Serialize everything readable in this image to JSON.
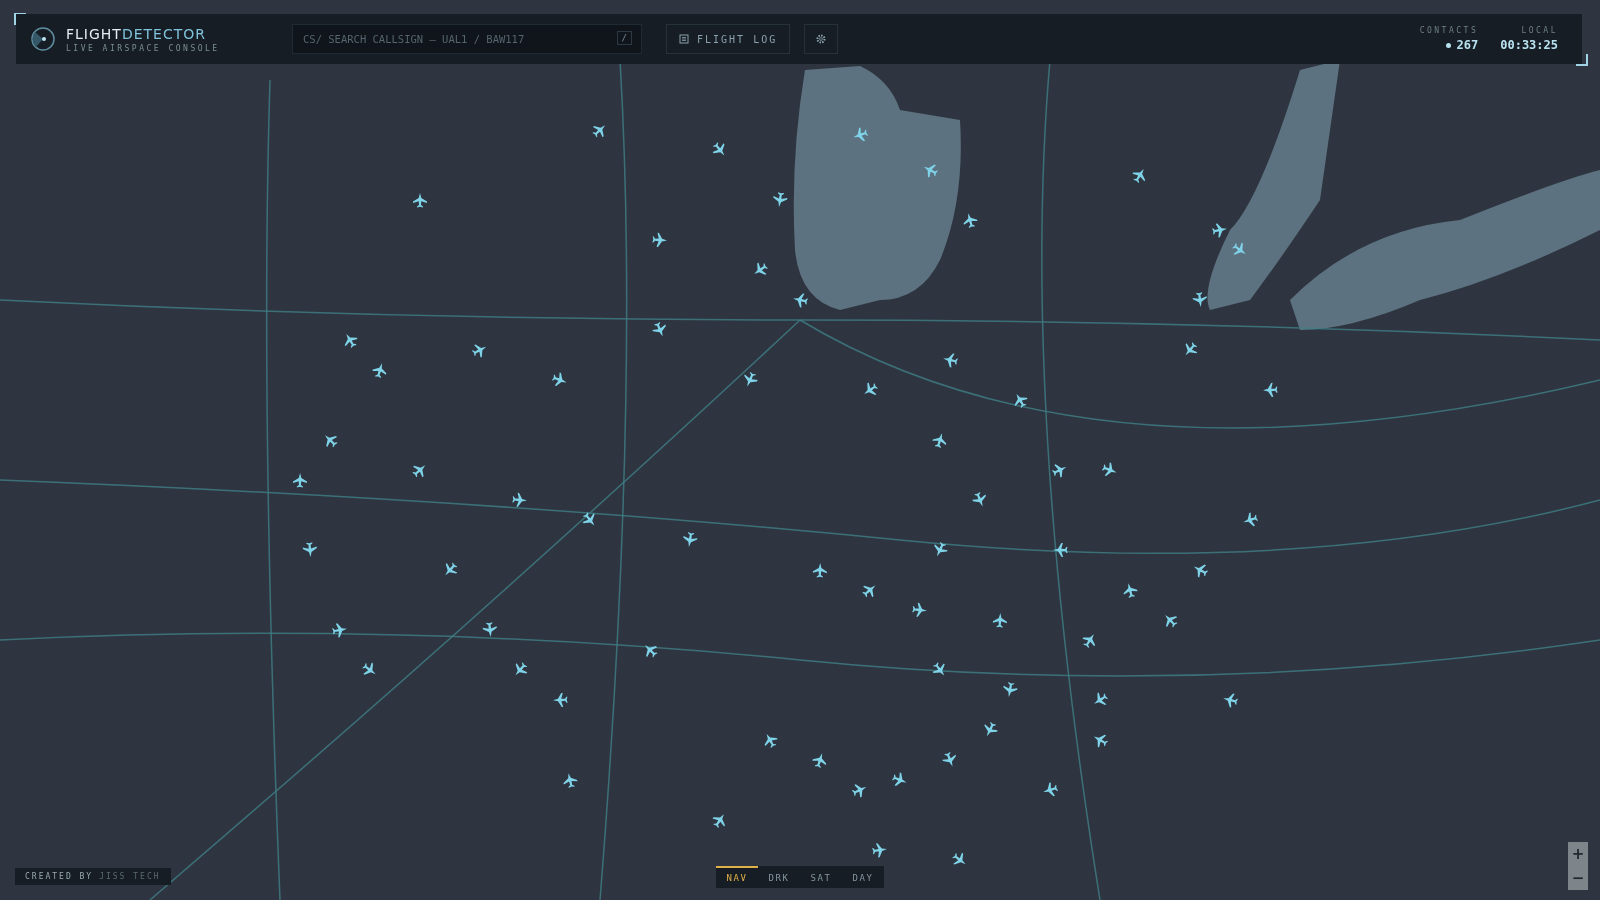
{
  "header": {
    "brand": {
      "primary": "FLIGHT",
      "accent": "DETECTOR",
      "subtitle": "LIVE AIRSPACE CONSOLE"
    },
    "search": {
      "placeholder": "CS/ SEARCH CALLSIGN — UAL1 / BAW117",
      "shortcut": "/"
    },
    "flight_log_button": "FLIGHT LOG",
    "stats": [
      {
        "label": "CONTACTS",
        "value": "267",
        "kind": "live"
      },
      {
        "label": "LOCAL",
        "value": "00:33:25",
        "kind": "plain"
      }
    ]
  },
  "credit": {
    "prefix": "CREATED BY",
    "brand": "JISS TECH"
  },
  "map_styles": [
    {
      "label": "NAV",
      "selected": true
    },
    {
      "label": "DRK",
      "selected": false
    },
    {
      "label": "SAT",
      "selected": false
    },
    {
      "label": "DAY",
      "selected": false
    }
  ],
  "zoom_controls": [
    "+",
    "−"
  ]
}
